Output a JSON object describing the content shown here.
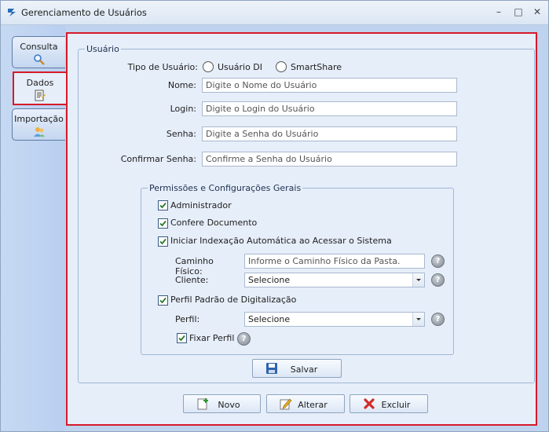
{
  "window": {
    "title": "Gerenciamento de Usuários",
    "minimize": "–",
    "maximize": "□",
    "close": "✕"
  },
  "tabs": [
    {
      "label": "Consulta",
      "icon": "magnifier-icon"
    },
    {
      "label": "Dados",
      "icon": "document-icon"
    },
    {
      "label": "Importação",
      "icon": "users-icon"
    }
  ],
  "user_group": {
    "legend": "Usuário",
    "tipo_label": "Tipo de Usuário:",
    "radio_di": "Usuário DI",
    "radio_smartshare": "SmartShare",
    "nome_label": "Nome:",
    "nome_placeholder": "Digite o Nome do Usuário",
    "login_label": "Login:",
    "login_placeholder": "Digite o Login do Usuário",
    "senha_label": "Senha:",
    "senha_placeholder": "Digite a Senha do Usuário",
    "confirmar_label": "Confirmar Senha:",
    "confirmar_placeholder": "Confirme a Senha do Usuário"
  },
  "perms_group": {
    "legend": "Permissões e Configurações Gerais",
    "administrador": "Administrador",
    "confere": "Confere Documento",
    "indexacao": "Iniciar Indexação Automática ao Acessar o Sistema",
    "caminho_label": "Caminho Físico:",
    "caminho_placeholder": "Informe o Caminho Físico da Pasta.",
    "cliente_label": "Cliente:",
    "cliente_value": "Selecione",
    "perfil_padrao": "Perfil Padrão de Digitalização",
    "perfil_label": "Perfil:",
    "perfil_value": "Selecione",
    "fixar": "Fixar Perfil",
    "help": "?"
  },
  "buttons": {
    "salvar": "Salvar",
    "novo": "Novo",
    "alterar": "Alterar",
    "excluir": "Excluir"
  },
  "colors": {
    "accent": "#d61a2a",
    "panel": "#e6eef9",
    "sidebar": "#bfd3ee"
  }
}
